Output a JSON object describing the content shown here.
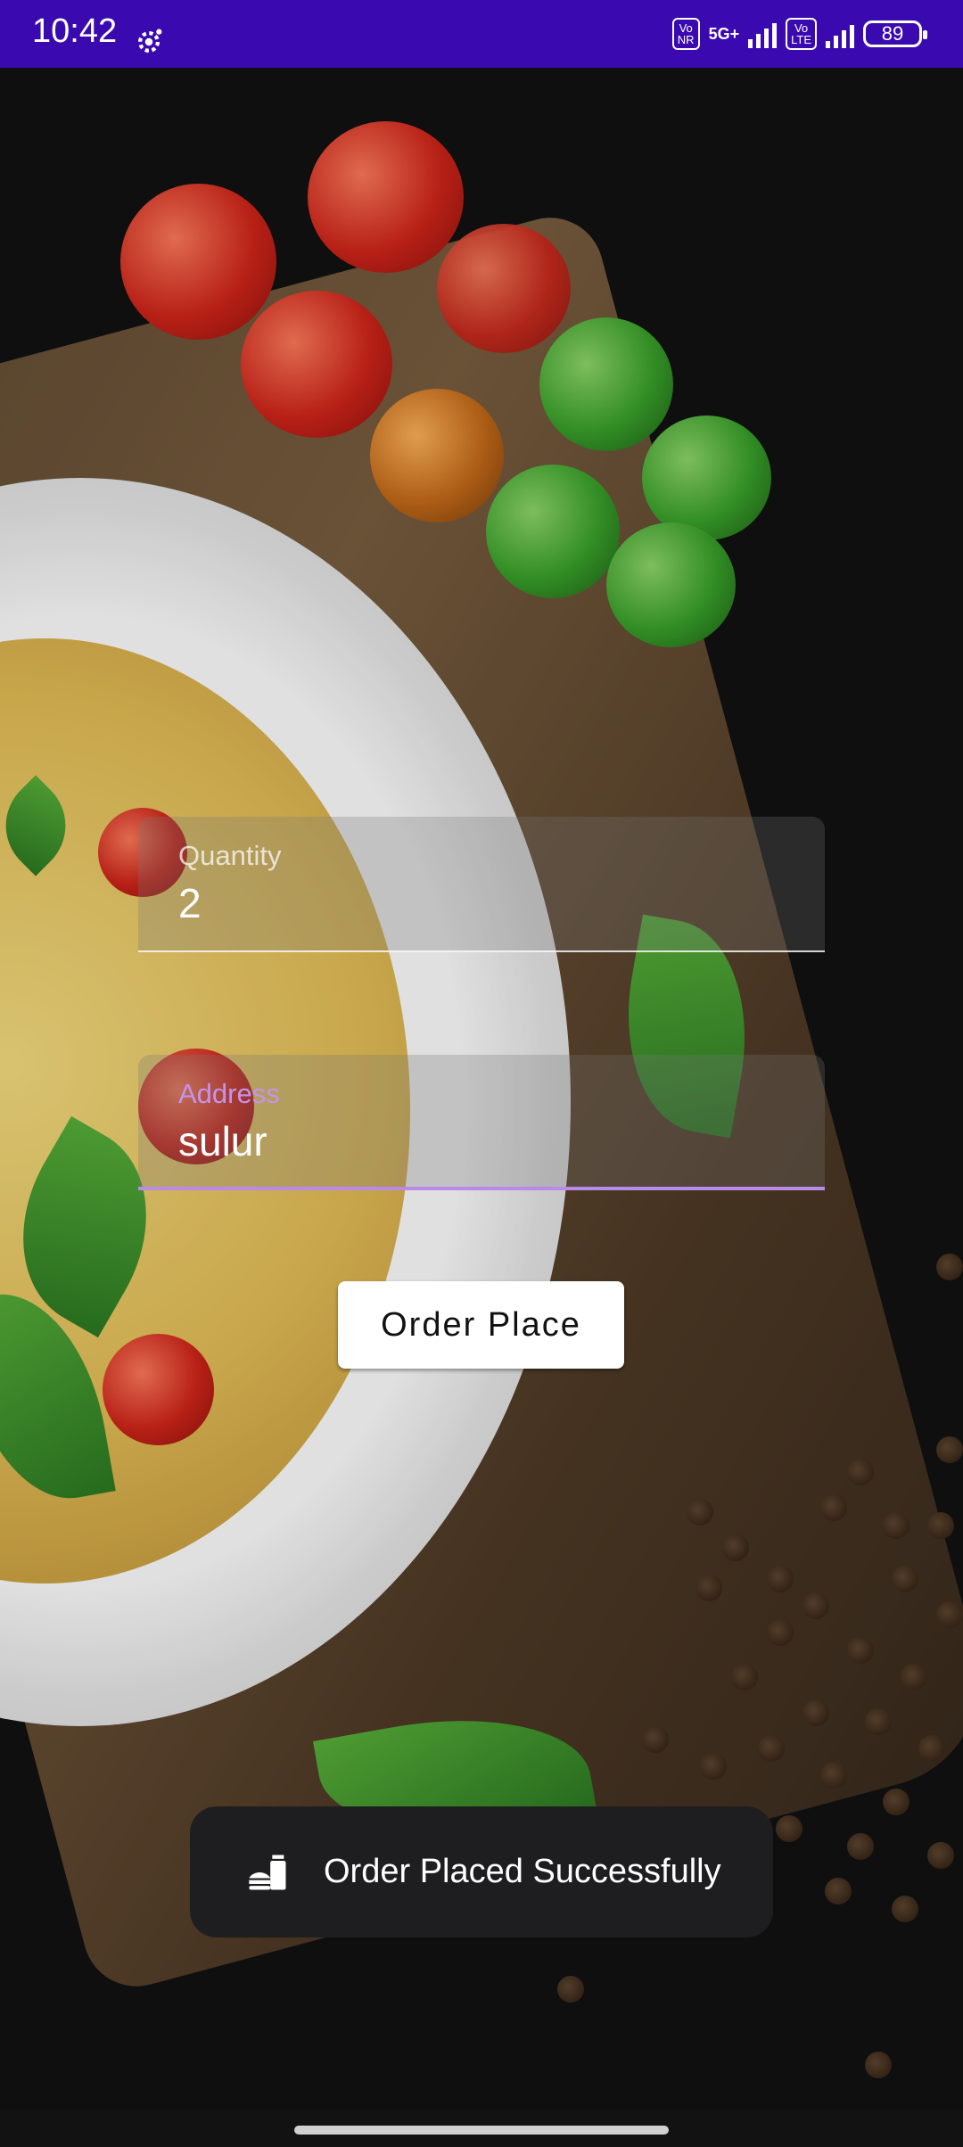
{
  "status_bar": {
    "time": "10:42",
    "volte1_top": "Vo",
    "volte1_bottom": "NR",
    "network_type": "5G+",
    "volte2_top": "Vo",
    "volte2_bottom": "LTE",
    "battery": "89"
  },
  "form": {
    "quantity_label": "Quantity",
    "quantity_value": "2",
    "address_label": "Address",
    "address_value": "sulur"
  },
  "order_button_label": "Order Place",
  "toast": {
    "icon": "food-icon",
    "message": "Order Placed Successfully"
  },
  "colors": {
    "status_bar": "#3a0ab0",
    "accent": "#b98ae6",
    "background": "#121212"
  }
}
